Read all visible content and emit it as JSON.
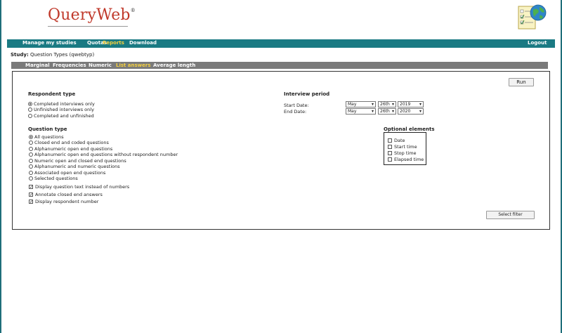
{
  "app": {
    "logo": "QueryWeb",
    "logo_mark": "®"
  },
  "nav": {
    "items": [
      {
        "label": "Manage my studies"
      },
      {
        "label": "Quotas"
      },
      {
        "label": "Reports"
      },
      {
        "label": "Download"
      }
    ],
    "logout": "Logout"
  },
  "study": {
    "label": "Study:",
    "name": "Question Types (qwebtyp)"
  },
  "subnav": {
    "items": [
      {
        "label": "Marginal"
      },
      {
        "label": "Frequencies"
      },
      {
        "label": "Numeric"
      },
      {
        "label": "List answers"
      },
      {
        "label": "Average length"
      }
    ]
  },
  "run_label": "Run",
  "select_filter_label": "Select filter",
  "respondent": {
    "title": "Respondent type",
    "options": [
      {
        "label": "Completed interviews only"
      },
      {
        "label": "Unfinished interviews only"
      },
      {
        "label": "Completed and unfinished"
      }
    ]
  },
  "period": {
    "title": "Interview period",
    "start_label": "Start Date:",
    "end_label": "End Date:",
    "start": {
      "month": "May",
      "day": "26th",
      "year": "2019"
    },
    "end": {
      "month": "May",
      "day": "26th",
      "year": "2020"
    }
  },
  "question_type": {
    "title": "Question type",
    "options": [
      {
        "label": "All questions"
      },
      {
        "label": "Closed end and coded questions"
      },
      {
        "label": "Alphanumeric open end questions"
      },
      {
        "label": "Alphanumeric open end questions without respondent number"
      },
      {
        "label": "Numeric open and closed end questions"
      },
      {
        "label": "Alphanumeric and numeric questions"
      },
      {
        "label": "Associated open end questions"
      },
      {
        "label": "Selected questions"
      }
    ],
    "checks": [
      {
        "label": "Display question text instead of numbers"
      },
      {
        "label": "Annotate closed end answers"
      },
      {
        "label": "Display respondent number"
      }
    ]
  },
  "optional": {
    "title": "Optional elements",
    "items": [
      {
        "label": "Date"
      },
      {
        "label": "Start time"
      },
      {
        "label": "Stop time"
      },
      {
        "label": "Elapsed time"
      }
    ]
  },
  "colors": {
    "nav_bg": "#1a7a83",
    "active": "#f4d03f",
    "logo_red": "#c0392b",
    "subnav_bg": "#7a7a7a"
  },
  "icons": {
    "corner_logo": "checklist-globe-icon",
    "select_arrow": "chevron-down-icon"
  }
}
